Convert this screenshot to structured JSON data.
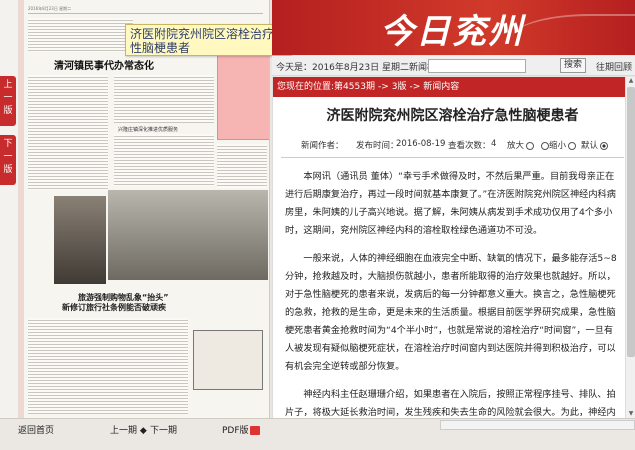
{
  "side_nav": {
    "prev_label": "上一版",
    "next_label": "下一版"
  },
  "paper": {
    "masthead": "2016年8月23日 星期二",
    "headline_main": "清河镇民事代办常态化",
    "headline_sub": "兴隆庄镇深化推进优质服务",
    "bottom_title_1": "旅游强制购物乱象“抬头”",
    "bottom_title_2": "新修订旅行社条例能否破顽疾"
  },
  "tooltip": {
    "text": "济医附院兖州院区溶栓治疗急性脑梗患者"
  },
  "banner": {
    "logo": "今日兖州"
  },
  "toolbar": {
    "date": "今天是：2016年8月23日 星期二新闻检索",
    "search_placeholder": "",
    "search_button": "搜索",
    "past_link": "往期回顾"
  },
  "article": {
    "crumb_label": "您现在的位置:",
    "crumb_issue": "第4553期",
    "crumb_page": "3版",
    "crumb_item": "新闻内容",
    "crumb_arrow": "->",
    "title": "济医附院兖州院区溶栓治疗急性脑梗患者",
    "meta_author_label": "新闻作者：",
    "meta_time_label": "发布时间：",
    "meta_time": "2016-08-19",
    "meta_views_label": "查看次数：",
    "meta_views": "4",
    "zoom_in": "放大",
    "zoom_out": "缩小",
    "zoom_default": "默认",
    "para1": "本网讯（通讯员 董体）“幸亏手术做得及时，不然后果严重。目前我母亲正在进行后期康复治疗，再过一段时间就基本康复了。”在济医附院兖州院区神经内科病房里，朱阿姨的儿子高兴地说。据了解，朱阿姨从病发到手术成功仅用了4个多小时，这期间，兖州院区神经内科的溶栓取栓绿色通道功不可没。",
    "para2": "一般来说，人体的神经细胞在血液完全中断、缺氧的情况下，最多能存活5~8分钟，抢救越及时，大脑损伤就越小，患者所能取得的治疗效果也就越好。所以，对于急性脑梗死的患者来说，发病后的每一分钟都意义重大。换言之，急性脑梗死的急救，抢救的是生命，更是未来的生活质量。根据目前医学界研究成果，急性脑梗死患者黄金抢救时间为“4个半小时”，也就是常说的溶栓治疗“时间窗”，一旦有人被发现有疑似脑梗死症状，在溶栓治疗时间窗内到达医院并得到积极治疗，可以有机会完全逆转或部分恢复。",
    "para3": "神经内科主任赵珊珊介绍，如果患者在入院后，按照正常程序挂号、排队、拍片子，将极大延长救治时间，发生残疾和失去生命的风险就会很大。为此，神经内科联合急诊科、神经外科、检验科、影像科等各科室为急性脑梗患者开通绿色通道程序，力争"
  },
  "bottombar": {
    "back": "返回首页",
    "prev_page": "上一期",
    "next_page": "下一期",
    "pdf": "PDF版"
  },
  "colors": {
    "brand_red": "#c22525",
    "tooltip_bg": "#fff9bf"
  }
}
